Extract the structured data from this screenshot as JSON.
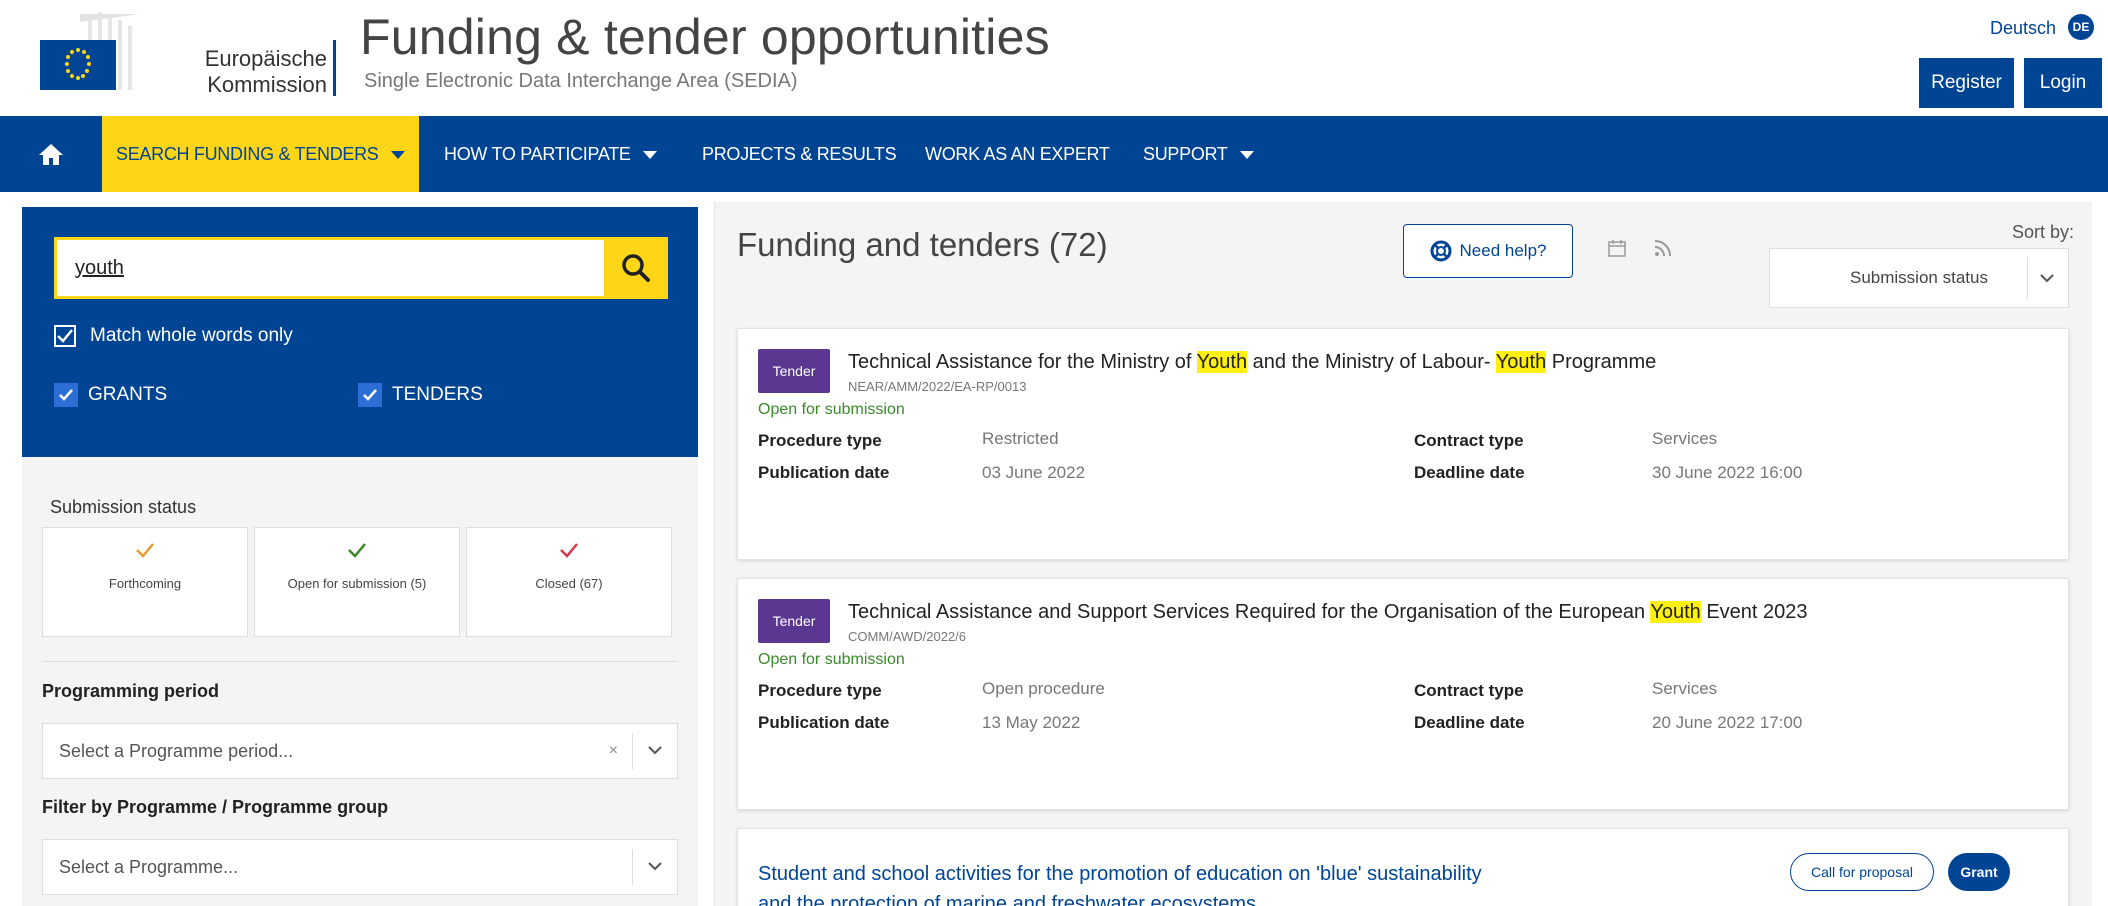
{
  "header": {
    "org_line1": "Europäische",
    "org_line2": "Kommission",
    "title": "Funding & tender opportunities",
    "subtitle": "Single Electronic Data Interchange Area (SEDIA)",
    "language": "Deutsch",
    "language_code": "DE",
    "register_label": "Register",
    "login_label": "Login"
  },
  "nav": {
    "home_icon": "home-icon",
    "items": [
      {
        "label": "SEARCH FUNDING & TENDERS",
        "active": true,
        "dropdown": true
      },
      {
        "label": "HOW TO PARTICIPATE",
        "dropdown": true
      },
      {
        "label": "PROJECTS & RESULTS",
        "dropdown": false
      },
      {
        "label": "WORK AS AN EXPERT",
        "dropdown": false
      },
      {
        "label": "SUPPORT",
        "dropdown": true
      }
    ]
  },
  "search": {
    "value": "youth",
    "match_whole_words_label": "Match whole words only",
    "grants_label": "GRANTS",
    "tenders_label": "TENDERS"
  },
  "filters": {
    "submission_status_label": "Submission status",
    "statuses": [
      {
        "label": "Forthcoming",
        "color": "#e89b2e"
      },
      {
        "label": "Open for submission (5)",
        "color": "#3a8a2a"
      },
      {
        "label": "Closed (67)",
        "color": "#d9354a"
      }
    ],
    "programming_period_label": "Programming period",
    "programming_period_placeholder": "Select a Programme period...",
    "programme_label": "Filter by Programme / Programme group",
    "programme_placeholder": "Select a Programme..."
  },
  "results": {
    "title": "Funding and tenders (72)",
    "need_help_label": "Need help?",
    "sort_label": "Sort by:",
    "sort_value": "Submission status",
    "cards": [
      {
        "tag": "Tender",
        "title_parts": [
          "Technical Assistance for the Ministry of ",
          "Youth",
          " and the Ministry of Labour- ",
          "Youth",
          " Programme"
        ],
        "id": "NEAR/AMM/2022/EA-RP/0013",
        "status": "Open for submission",
        "procedure_type_label": "Procedure type",
        "procedure_type": "Restricted",
        "publication_date_label": "Publication date",
        "publication_date": "03 June 2022",
        "contract_type_label": "Contract type",
        "contract_type": "Services",
        "deadline_date_label": "Deadline date",
        "deadline_date": "30 June 2022 16:00"
      },
      {
        "tag": "Tender",
        "title_parts": [
          "Technical Assistance and Support Services Required for the Organisation of the European ",
          "Youth",
          " Event 2023"
        ],
        "id": "COMM/AWD/2022/6",
        "status": "Open for submission",
        "procedure_type_label": "Procedure type",
        "procedure_type": "Open procedure",
        "publication_date_label": "Publication date",
        "publication_date": "13 May 2022",
        "contract_type_label": "Contract type",
        "contract_type": "Services",
        "deadline_date_label": "Deadline date",
        "deadline_date": "20 June 2022 17:00"
      },
      {
        "title_line1": "Student and school activities for the promotion of education on 'blue' sustainability",
        "title_line2": "and the protection of marine and freshwater ecosystems",
        "call_type": "Call for proposal",
        "kind": "Grant"
      }
    ]
  },
  "colors": {
    "ec_blue": "#004494",
    "eu_yellow": "#ffd617",
    "tender_purple": "#5a3892",
    "open_green": "#3a8a2a",
    "highlight": "#ffef12"
  }
}
